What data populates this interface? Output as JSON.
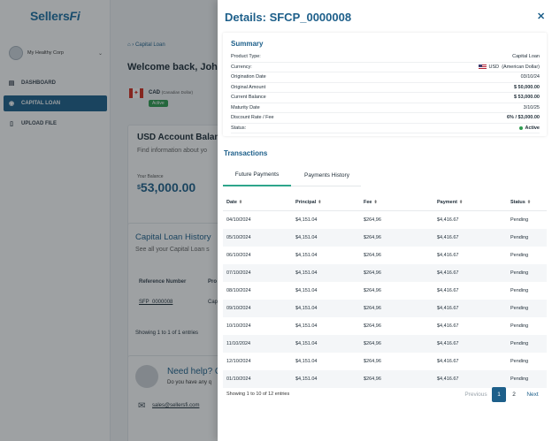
{
  "sidebar": {
    "logo_main": "Sellers",
    "logo_accent": "Fi",
    "company": "My Healthy Corp",
    "items": [
      {
        "label": "DASHBOARD",
        "icon": "chart-icon"
      },
      {
        "label": "CAPITAL LOAN",
        "icon": "dollar-icon"
      },
      {
        "label": "UPLOAD FILE",
        "icon": "file-icon"
      }
    ]
  },
  "main": {
    "breadcrumb": "Capital Loan",
    "welcome": "Welcome back, John!",
    "currency_code": "CAD",
    "currency_name": "(Canadian Dollar)",
    "currency_status": "Active",
    "balance_card": {
      "title": "USD Account Balance",
      "subtitle": "Find information about yo",
      "label": "Your Balance",
      "currency_symbol": "$",
      "value": "53,000.00"
    },
    "history_card": {
      "title": "Capital Loan History",
      "subtitle": "See all your Capital Loan s",
      "col_reference": "Reference Number",
      "col_product": "Pro",
      "row_reference": "SFP_0000008",
      "row_product": "Cap",
      "showing": "Showing 1 to 1 of 1 entries"
    },
    "help_card": {
      "title": "Need help? C",
      "subtitle": "Do you have any q",
      "email": "sales@sellersfi.com"
    }
  },
  "drawer": {
    "title": "Details: SFCP_0000008",
    "close_icon": "✕",
    "summary": {
      "title": "Summary",
      "rows": [
        {
          "label": "Product Type:",
          "value": "Capital Loan"
        },
        {
          "label": "Currency:",
          "value": "USD",
          "value_extra": "(American Dollar)"
        },
        {
          "label": "Origination Date",
          "value": "03/10/24"
        },
        {
          "label": "Original Amount",
          "value": "$ 50,000.00"
        },
        {
          "label": "Current Balance",
          "value": "$ 53,000.00"
        },
        {
          "label": "Maturity Date",
          "value": "3/10/25"
        },
        {
          "label": "Discount Rate / Fee",
          "value": "6% / $3,000.00"
        },
        {
          "label": "Status:",
          "value": "Active"
        }
      ]
    },
    "transactions_title": "Transactions",
    "tabs": [
      "Future Payments",
      "Payments History"
    ],
    "columns": [
      "Date",
      "Principal",
      "Fee",
      "Payment",
      "Status"
    ],
    "rows": [
      [
        "04/10/2024",
        "$4,151.04",
        "$264,96",
        "$4,416.67",
        "Pending"
      ],
      [
        "05/10/2024",
        "$4,151.04",
        "$264,96",
        "$4,416.67",
        "Pending"
      ],
      [
        "06/10/2024",
        "$4,151.04",
        "$264,96",
        "$4,416.67",
        "Pending"
      ],
      [
        "07/10/2024",
        "$4,151.04",
        "$264,96",
        "$4,416.67",
        "Pending"
      ],
      [
        "08/10/2024",
        "$4,151.04",
        "$264,96",
        "$4,416.67",
        "Pending"
      ],
      [
        "09/10/2024",
        "$4,151.04",
        "$264,96",
        "$4,416.67",
        "Pending"
      ],
      [
        "10/10/2024",
        "$4,151.04",
        "$264,96",
        "$4,416.67",
        "Pending"
      ],
      [
        "11/10/2024",
        "$4,151.04",
        "$264,96",
        "$4,416.67",
        "Pending"
      ],
      [
        "12/10/2024",
        "$4,151.04",
        "$264,96",
        "$4,416.67",
        "Pending"
      ],
      [
        "01/10/2024",
        "$4,151.04",
        "$264,96",
        "$4,416.67",
        "Pending"
      ]
    ],
    "showing": "Showing 1 to 10 of 12 entries",
    "pagination": {
      "previous": "Previous",
      "pages": [
        "1",
        "2"
      ],
      "next": "Next"
    }
  },
  "colors": {
    "primary": "#1d5f8a",
    "success": "#2e9b4f",
    "tab_accent": "#2ea58b"
  }
}
